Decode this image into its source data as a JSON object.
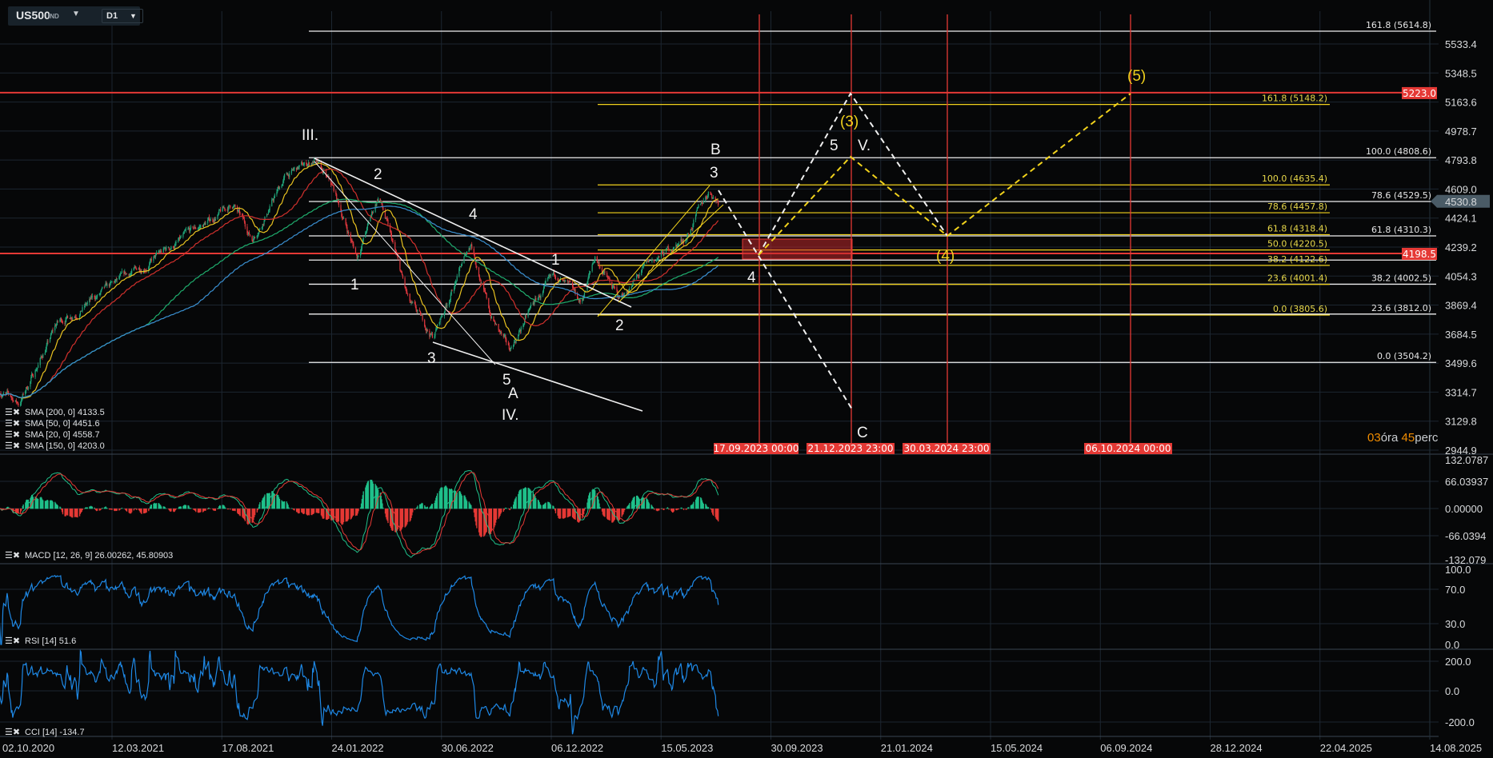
{
  "symbol": {
    "name": "US500",
    "type": "IND",
    "timeframe": "D1"
  },
  "price_axis": [
    "5533.4",
    "5348.5",
    "5163.6",
    "4978.7",
    "4793.8",
    "4609.0",
    "4424.1",
    "4239.2",
    "4054.3",
    "3869.4",
    "3684.5",
    "3499.6",
    "3314.7",
    "3129.8",
    "2944.9"
  ],
  "current_price": {
    "value": 4530.8,
    "label": "4530.8"
  },
  "price_lines": [
    {
      "value": 5223.0,
      "label": "5223.0"
    },
    {
      "value": 4198.5,
      "label": "4198.5"
    }
  ],
  "fib_white": [
    {
      "price": 5614.8,
      "label": "161.8 (5614.8)"
    },
    {
      "price": 4808.6,
      "label": "100.0 (4808.6)"
    },
    {
      "price": 4529.5,
      "label": "78.6 (4529.5)"
    },
    {
      "price": 4310.3,
      "label": "61.8 (4310.3)"
    },
    {
      "price": 4156.4,
      "label": "50.0 ("
    },
    {
      "price": 4002.5,
      "label": "38.2 (4002.5)"
    },
    {
      "price": 3812.0,
      "label": "23.6 (3812.0)"
    },
    {
      "price": 3504.2,
      "label": "0.0 (3504.2)"
    }
  ],
  "fib_yellow": [
    {
      "price": 5148.2,
      "label": "161.8 (5148.2)"
    },
    {
      "price": 4635.4,
      "label": "100.0 (4635.4)"
    },
    {
      "price": 4457.8,
      "label": "78.6 (4457.8)"
    },
    {
      "price": 4318.4,
      "label": "61.8 (4318.4)"
    },
    {
      "price": 4220.5,
      "label": "50.0 (4220.5)"
    },
    {
      "price": 4122.6,
      "label": "38.2 (4122.6)"
    },
    {
      "price": 4001.4,
      "label": "23.6 (4001.4)"
    },
    {
      "price": 3805.6,
      "label": "0.0 (3805.6)"
    }
  ],
  "time_markers": [
    "17.09.2023 00:00",
    "21.12.2023 23:00",
    "30.03.2024 23:00",
    "06.10.2024 00:00"
  ],
  "waves": {
    "iii": "III.",
    "w1": "1",
    "w2": "2",
    "w3": "3",
    "w4": "4",
    "w5": "5",
    "a": "A",
    "iv": "IV.",
    "s1": "1",
    "s2": "2",
    "b": "B",
    "s3": "3",
    "s4": "4",
    "c": "C",
    "s5": "5",
    "v": "V.",
    "y3": "(3)",
    "y4": "(4)",
    "y5": "(5)"
  },
  "countdown": {
    "hours": "03",
    "hours_unit": "óra",
    "minutes": "45",
    "minutes_unit": "perc"
  },
  "legend": {
    "sma200": "SMA [200,  0] 4133.5",
    "sma50": "SMA [50,  0] 4451.6",
    "sma20": "SMA [20,  0] 4558.7",
    "sma150": "SMA [150,  0] 4203.0",
    "macd": "MACD  [12,  26,  9] 26.00262,   45.80903",
    "rsi": "RSI  [14]  51.6",
    "cci": "CCI  [14]  -134.7"
  },
  "macd_axis": [
    "132.0787",
    "66.03937",
    "0.00000",
    "-66.0394",
    "-132.079"
  ],
  "rsi_axis": [
    "100.0",
    "70.0",
    "30.0",
    "0.0"
  ],
  "cci_axis": [
    "200.0",
    "0.0",
    "-200.0"
  ],
  "date_axis": [
    "02.10.2020",
    "12.03.2021",
    "17.08.2021",
    "24.01.2022",
    "30.06.2022",
    "06.12.2022",
    "15.05.2023",
    "30.09.2023",
    "21.01.2024",
    "15.05.2024",
    "06.09.2024",
    "28.12.2024",
    "22.04.2025",
    "14.08.2025"
  ],
  "colors": {
    "up": "#1fa67a",
    "down": "#e0383e",
    "sma20": "#e8c220",
    "sma50": "#d0302c",
    "sma150": "#1fae6e",
    "sma200": "#3a8fd0",
    "marker": "#e53935",
    "fib_yellow": "#f1d21c"
  },
  "chart_data": {
    "type": "candlestick",
    "title": "US500 D1",
    "ylim": [
      2944.9,
      5533.4
    ],
    "anchors": [
      [
        "2020-10-02",
        3327
      ],
      [
        "2020-10-31",
        3240
      ],
      [
        "2020-12-24",
        3750
      ],
      [
        "2021-03-15",
        3994
      ],
      [
        "2021-06-04",
        4239
      ],
      [
        "2021-08-31",
        4509
      ],
      [
        "2021-09-27",
        4290
      ],
      [
        "2021-11-14",
        4692
      ],
      [
        "2021-12-24",
        4790
      ],
      [
        "2022-01-20",
        4601
      ],
      [
        "2022-02-23",
        4178
      ],
      [
        "2022-03-26",
        4570
      ],
      [
        "2022-05-08",
        3872
      ],
      [
        "2022-06-11",
        3663
      ],
      [
        "2022-08-04",
        4270
      ],
      [
        "2022-08-31",
        3811
      ],
      [
        "2022-09-27",
        3572
      ],
      [
        "2022-10-31",
        3872
      ],
      [
        "2022-12-04",
        4056
      ],
      [
        "2023-01-07",
        3872
      ],
      [
        "2023-01-27",
        4178
      ],
      [
        "2023-03-02",
        3903
      ],
      [
        "2023-04-11",
        4117
      ],
      [
        "2023-06-05",
        4300
      ],
      [
        "2023-07-08",
        4601
      ],
      [
        "2023-07-22",
        4530
      ]
    ],
    "sma_periods": [
      20,
      50,
      150,
      200
    ]
  }
}
